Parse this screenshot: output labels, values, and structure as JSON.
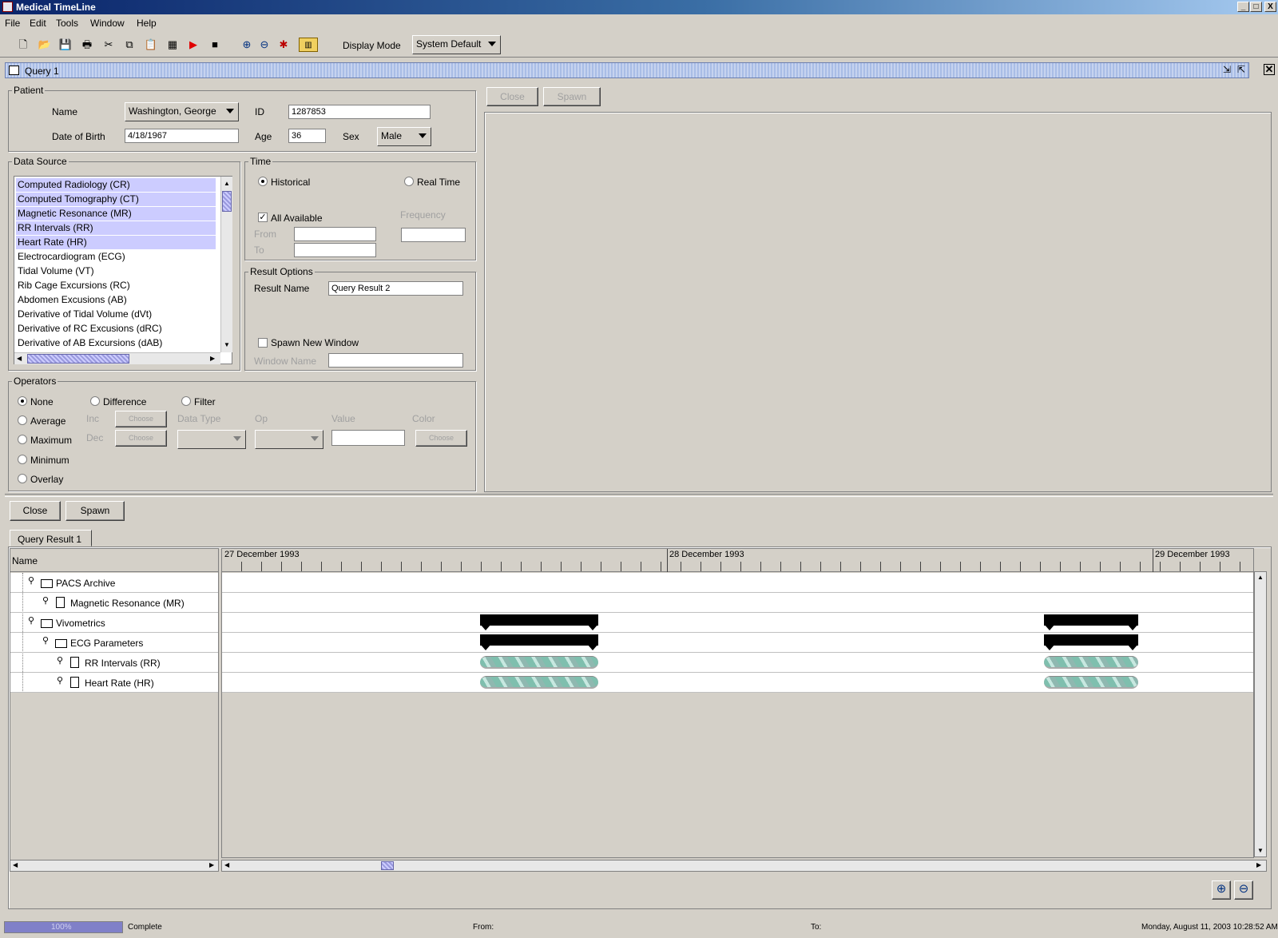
{
  "window": {
    "title": "Medical TimeLine",
    "min": "_",
    "max": "□",
    "close": "X"
  },
  "menu": [
    "File",
    "Edit",
    "Tools",
    "Window",
    "Help"
  ],
  "toolbar": {
    "display_mode_label": "Display Mode",
    "display_mode_value": "System Default"
  },
  "query_window": {
    "title": "Query 1"
  },
  "patient": {
    "group": "Patient",
    "name_label": "Name",
    "name_value": "Washington, George",
    "id_label": "ID",
    "id_value": "1287853",
    "dob_label": "Date of Birth",
    "dob_value": "4/18/1967",
    "age_label": "Age",
    "age_value": "36",
    "sex_label": "Sex",
    "sex_value": "Male"
  },
  "data_source": {
    "group": "Data Source",
    "items": [
      {
        "label": "Computed Radiology (CR)",
        "selected": true
      },
      {
        "label": "Computed Tomography (CT)",
        "selected": true
      },
      {
        "label": "Magnetic Resonance (MR)",
        "selected": true
      },
      {
        "label": "RR Intervals (RR)",
        "selected": true
      },
      {
        "label": "Heart Rate (HR)",
        "selected": true
      },
      {
        "label": "Electrocardiogram (ECG)",
        "selected": false
      },
      {
        "label": "Tidal Volume (VT)",
        "selected": false
      },
      {
        "label": "Rib Cage Excursions (RC)",
        "selected": false
      },
      {
        "label": "Abdomen Excusions (AB)",
        "selected": false
      },
      {
        "label": "Derivative of Tidal Volume (dVt)",
        "selected": false
      },
      {
        "label": "Derivative of RC Excusions (dRC)",
        "selected": false
      },
      {
        "label": "Derivative of AB Excursions (dAB)",
        "selected": false
      }
    ]
  },
  "time": {
    "group": "Time",
    "historical": "Historical",
    "real_time": "Real Time",
    "all_available": "All Available",
    "frequency": "Frequency",
    "from": "From",
    "to": "To"
  },
  "result_options": {
    "group": "Result Options",
    "result_name_label": "Result Name",
    "result_name_value": "Query Result 2",
    "spawn_new_window": "Spawn New Window",
    "window_name_label": "Window Name"
  },
  "operators": {
    "group": "Operators",
    "none": "None",
    "average": "Average",
    "maximum": "Maximum",
    "minimum": "Minimum",
    "overlay": "Overlay",
    "difference": "Difference",
    "filter": "Filter",
    "inc": "Inc",
    "dec": "Dec",
    "choose": "Choose",
    "data_type": "Data Type",
    "op": "Op",
    "value": "Value",
    "color": "Color"
  },
  "preview": {
    "close": "Close",
    "spawn": "Spawn"
  },
  "results": {
    "close": "Close",
    "spawn": "Spawn",
    "tab": "Query Result 1",
    "name_header": "Name",
    "dates": [
      "27 December 1993",
      "28 December 1993",
      "29 December 1993"
    ],
    "tree": [
      "PACS Archive",
      "Magnetic Resonance (MR)",
      "Vivometrics",
      "ECG Parameters",
      "RR Intervals (RR)",
      "Heart Rate (HR)"
    ]
  },
  "status": {
    "progress_text": "100%",
    "progress": 1.0,
    "state": "Complete",
    "from_label": "From:",
    "to_label": "To:",
    "datetime": "Monday, August 11, 2003 10:28:52 AM"
  },
  "icons": [
    "new-icon",
    "open-icon",
    "save-icon",
    "print-icon",
    "cut-icon",
    "copy-icon",
    "paste-icon",
    "table-icon",
    "play-icon",
    "stop-icon",
    "zoom-in-icon",
    "zoom-out-icon",
    "settings-icon",
    "chart-icon"
  ]
}
